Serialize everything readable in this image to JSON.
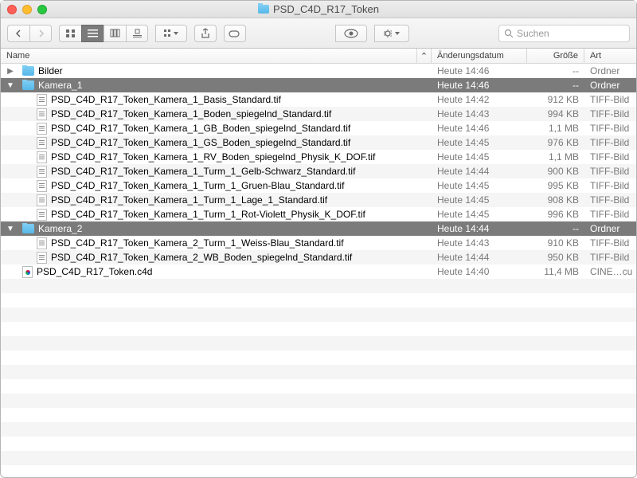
{
  "window": {
    "title": "PSD_C4D_R17_Token"
  },
  "toolbar": {
    "search_placeholder": "Suchen"
  },
  "columns": {
    "name": "Name",
    "date": "Änderungsdatum",
    "size": "Größe",
    "kind": "Art",
    "sort_indicator": "⌃"
  },
  "rows": [
    {
      "indent": 0,
      "disclosure": "▶",
      "icon": "folder",
      "name": "Bilder",
      "date": "Heute 14:46",
      "size": "--",
      "kind": "Ordner",
      "selected": false
    },
    {
      "indent": 0,
      "disclosure": "▼",
      "icon": "folder",
      "name": "Kamera_1",
      "date": "Heute 14:46",
      "size": "--",
      "kind": "Ordner",
      "selected": true
    },
    {
      "indent": 1,
      "disclosure": "",
      "icon": "tif",
      "name": "PSD_C4D_R17_Token_Kamera_1_Basis_Standard.tif",
      "date": "Heute 14:42",
      "size": "912 KB",
      "kind": "TIFF-Bild",
      "selected": false
    },
    {
      "indent": 1,
      "disclosure": "",
      "icon": "tif",
      "name": "PSD_C4D_R17_Token_Kamera_1_Boden_spiegelnd_Standard.tif",
      "date": "Heute 14:43",
      "size": "994 KB",
      "kind": "TIFF-Bild",
      "selected": false
    },
    {
      "indent": 1,
      "disclosure": "",
      "icon": "tif",
      "name": "PSD_C4D_R17_Token_Kamera_1_GB_Boden_spiegelnd_Standard.tif",
      "date": "Heute 14:46",
      "size": "1,1 MB",
      "kind": "TIFF-Bild",
      "selected": false
    },
    {
      "indent": 1,
      "disclosure": "",
      "icon": "tif",
      "name": "PSD_C4D_R17_Token_Kamera_1_GS_Boden_spiegelnd_Standard.tif",
      "date": "Heute 14:45",
      "size": "976 KB",
      "kind": "TIFF-Bild",
      "selected": false
    },
    {
      "indent": 1,
      "disclosure": "",
      "icon": "tif",
      "name": "PSD_C4D_R17_Token_Kamera_1_RV_Boden_spiegelnd_Physik_K_DOF.tif",
      "date": "Heute 14:45",
      "size": "1,1 MB",
      "kind": "TIFF-Bild",
      "selected": false
    },
    {
      "indent": 1,
      "disclosure": "",
      "icon": "tif",
      "name": "PSD_C4D_R17_Token_Kamera_1_Turm_1_Gelb-Schwarz_Standard.tif",
      "date": "Heute 14:44",
      "size": "900 KB",
      "kind": "TIFF-Bild",
      "selected": false
    },
    {
      "indent": 1,
      "disclosure": "",
      "icon": "tif",
      "name": "PSD_C4D_R17_Token_Kamera_1_Turm_1_Gruen-Blau_Standard.tif",
      "date": "Heute 14:45",
      "size": "995 KB",
      "kind": "TIFF-Bild",
      "selected": false
    },
    {
      "indent": 1,
      "disclosure": "",
      "icon": "tif",
      "name": "PSD_C4D_R17_Token_Kamera_1_Turm_1_Lage_1_Standard.tif",
      "date": "Heute 14:45",
      "size": "908 KB",
      "kind": "TIFF-Bild",
      "selected": false
    },
    {
      "indent": 1,
      "disclosure": "",
      "icon": "tif",
      "name": "PSD_C4D_R17_Token_Kamera_1_Turm_1_Rot-Violett_Physik_K_DOF.tif",
      "date": "Heute 14:45",
      "size": "996 KB",
      "kind": "TIFF-Bild",
      "selected": false
    },
    {
      "indent": 0,
      "disclosure": "▼",
      "icon": "folder",
      "name": "Kamera_2",
      "date": "Heute 14:44",
      "size": "--",
      "kind": "Ordner",
      "selected": true
    },
    {
      "indent": 1,
      "disclosure": "",
      "icon": "tif",
      "name": "PSD_C4D_R17_Token_Kamera_2_Turm_1_Weiss-Blau_Standard.tif",
      "date": "Heute 14:43",
      "size": "910 KB",
      "kind": "TIFF-Bild",
      "selected": false
    },
    {
      "indent": 1,
      "disclosure": "",
      "icon": "tif",
      "name": "PSD_C4D_R17_Token_Kamera_2_WB_Boden_spiegelnd_Standard.tif",
      "date": "Heute 14:44",
      "size": "950 KB",
      "kind": "TIFF-Bild",
      "selected": false
    },
    {
      "indent": 0,
      "disclosure": "",
      "icon": "c4d",
      "name": "PSD_C4D_R17_Token.c4d",
      "date": "Heute 14:40",
      "size": "11,4 MB",
      "kind": "CINE…cu",
      "selected": false
    }
  ]
}
